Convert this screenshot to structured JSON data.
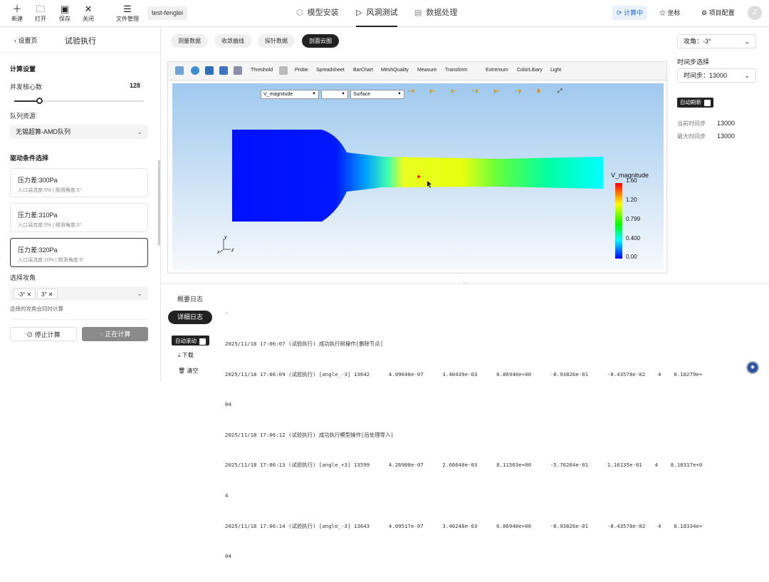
{
  "toolbar": {
    "new": "新建",
    "open": "打开",
    "save": "保存",
    "close": "关闭",
    "file_mgmt": "文件管理",
    "project_name": "test-fenglei"
  },
  "nav": {
    "model_install": "模型安装",
    "wind_tunnel": "风洞测试",
    "data_processing": "数据处理"
  },
  "topright": {
    "calculating": "计算中",
    "coordinate": "坐标",
    "project_config": "项目配置",
    "avatar": "Z"
  },
  "left": {
    "back": "设置页",
    "title": "试验执行",
    "compute_settings": "计算设置",
    "cores_label": "并发核心数",
    "cores_value": "128",
    "cores_fraction": 0.2,
    "queue_label": "队列资源",
    "queue_value": "无锡超算-AMD队列",
    "drive_label": "驱动条件选择",
    "cards": [
      {
        "title": "压力差:300Pa",
        "sub": "入口湍流度:5% | 侧滑角度:5°"
      },
      {
        "title": "压力差:310Pa",
        "sub": "入口湍流度:5% | 侧滑角度:5°"
      },
      {
        "title": "压力差:320Pa",
        "sub": "入口湍流度:10% | 侧滑角度:5°"
      }
    ],
    "aoa_label": "选择攻角",
    "aoa_tags": [
      "-3°",
      "3°"
    ],
    "aoa_hint": "选择的攻角会同时计算",
    "stop_btn": "停止计算",
    "running_btn": "正在计算"
  },
  "tabs": [
    "测量数据",
    "收敛曲线",
    "探针数据",
    "剖面云图"
  ],
  "viewer": {
    "tools": [
      "Threshold",
      "Probe",
      "Spreadsheet",
      "BarChart",
      "MeshQuality",
      "Measure",
      "Transform",
      "Extremum",
      "ColorLibary",
      "Light"
    ],
    "field_select": "V_magnitude",
    "repr_select": "Surface",
    "colorbar_title": "V_magnitude",
    "colorbar_ticks": [
      "1.60",
      "1.20",
      "0.799",
      "0.400",
      "0.00"
    ],
    "axis_labels": {
      "y": "y",
      "x": "x",
      "z": "z"
    }
  },
  "right": {
    "aoa_label": "攻角：",
    "aoa_value": "-3°",
    "timestep_select_label": "时间步选择",
    "timestep_label": "时间步：",
    "timestep_value": "13000",
    "auto_refresh": "自动刷新",
    "current_step_label": "当前时间步",
    "current_step_value": "13000",
    "max_step_label": "最大时间步",
    "max_step_value": "13000"
  },
  "log": {
    "summary_btn": "概要日志",
    "detail_btn": "详细日志",
    "auto_scroll": "自动滚动",
    "download": "下载",
    "clear": "清空",
    "lines": [
      "-",
      "2025/11/18 17:06:07 (试验执行) 成功执行树操作[删除节点]",
      "2025/11/18 17:06:09 (试验执行) [angle_-3] 13642      4.09648e-07      3.40439e-03      6.86940e+00      -8.93826e-01      -8.43578e-02    4    8.18279e+",
      "04",
      "2025/11/18 17:06:12 (试验执行) 成功执行模型操作[后处理导入]",
      "2025/11/18 17:06:13 (试验执行) [angle_+3] 13599      4.26908e-07      2.66640e-03      8.11563e+00      -5.76264e-01      1.16135e-01    4    8.18317e+0",
      "4",
      "2025/11/18 17:06:14 (试验执行) [angle_-3] 13643      4.09517e-07      3.40248e-03      6.86940e+00      -8.93826e-01      -8.43578e-02    4    8.18334e+",
      "04"
    ]
  }
}
